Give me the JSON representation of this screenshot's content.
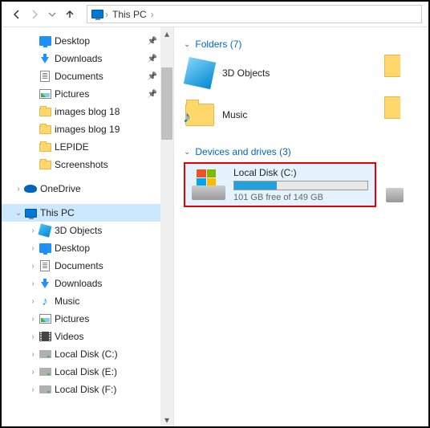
{
  "toolbar": {
    "breadcrumb": [
      "This PC"
    ]
  },
  "nav": {
    "items": [
      {
        "label": "Desktop",
        "icon": "desktop",
        "pinned": true,
        "depth": 1
      },
      {
        "label": "Downloads",
        "icon": "down",
        "pinned": true,
        "depth": 1
      },
      {
        "label": "Documents",
        "icon": "doc",
        "pinned": true,
        "depth": 1
      },
      {
        "label": "Pictures",
        "icon": "pic",
        "pinned": true,
        "depth": 1
      },
      {
        "label": "images blog 18",
        "icon": "folder",
        "depth": 1
      },
      {
        "label": "images blog 19",
        "icon": "folder",
        "depth": 1
      },
      {
        "label": "LEPIDE",
        "icon": "folder",
        "depth": 1
      },
      {
        "label": "Screenshots",
        "icon": "folder",
        "depth": 1
      },
      {
        "spacer": true
      },
      {
        "label": "OneDrive",
        "icon": "onedrive",
        "exp": ">",
        "depth": 0
      },
      {
        "spacer": true
      },
      {
        "label": "This PC",
        "icon": "monitor",
        "exp": "v",
        "depth": 0,
        "sel": true
      },
      {
        "label": "3D Objects",
        "icon": "3d",
        "exp": ">",
        "depth": 1
      },
      {
        "label": "Desktop",
        "icon": "desktop",
        "exp": ">",
        "depth": 1
      },
      {
        "label": "Documents",
        "icon": "doc",
        "exp": ">",
        "depth": 1
      },
      {
        "label": "Downloads",
        "icon": "down",
        "exp": ">",
        "depth": 1
      },
      {
        "label": "Music",
        "icon": "music",
        "exp": ">",
        "depth": 1
      },
      {
        "label": "Pictures",
        "icon": "pic",
        "exp": ">",
        "depth": 1
      },
      {
        "label": "Videos",
        "icon": "video",
        "exp": ">",
        "depth": 1
      },
      {
        "label": "Local Disk (C:)",
        "icon": "drive",
        "exp": ">",
        "depth": 1
      },
      {
        "label": "Local Disk (E:)",
        "icon": "drive",
        "exp": ">",
        "depth": 1
      },
      {
        "label": "Local Disk (F:)",
        "icon": "drive",
        "exp": ">",
        "depth": 1
      }
    ]
  },
  "content": {
    "folders_header": "Folders (7)",
    "devices_header": "Devices and drives (3)",
    "folders": [
      {
        "label": "3D Objects",
        "icon": "3d"
      },
      {
        "label": "Music",
        "icon": "music"
      }
    ],
    "drive": {
      "name": "Local Disk (C:)",
      "free_text": "101 GB free of 149 GB",
      "used_pct": 32
    }
  }
}
